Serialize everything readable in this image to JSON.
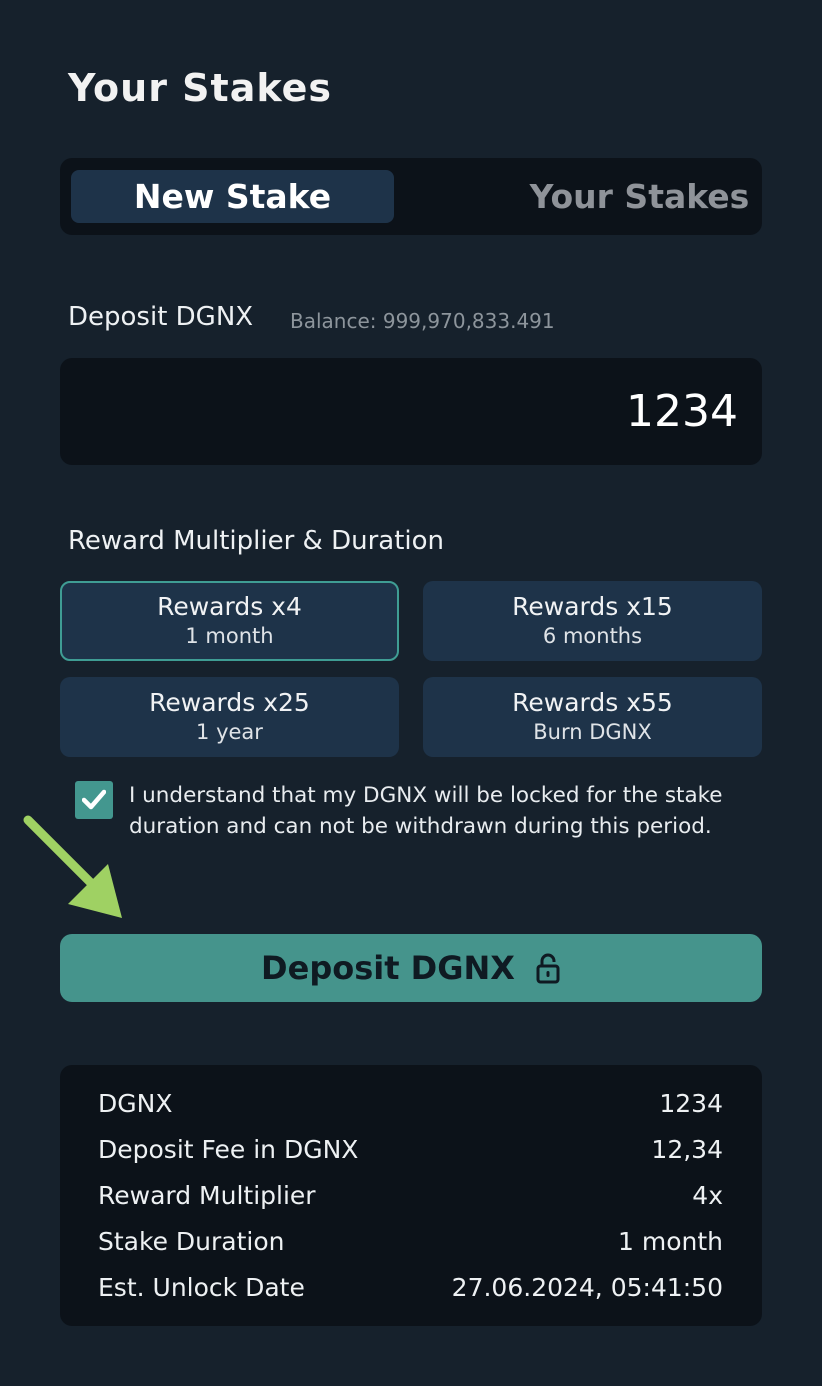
{
  "page": {
    "title": "Your Stakes"
  },
  "tabs": [
    {
      "label": "New Stake",
      "active": true
    },
    {
      "label": "Your Stakes",
      "active": false
    }
  ],
  "deposit": {
    "label": "Deposit DGNX",
    "balance": "Balance: 999,970,833.491",
    "amount_value": "1234"
  },
  "multiplier": {
    "label": "Reward Multiplier & Duration",
    "options": [
      {
        "title": "Rewards x4",
        "sub": "1 month",
        "selected": true
      },
      {
        "title": "Rewards x15",
        "sub": "6 months",
        "selected": false
      },
      {
        "title": "Rewards x25",
        "sub": "1 year",
        "selected": false
      },
      {
        "title": "Rewards x55",
        "sub": "Burn DGNX",
        "selected": false
      }
    ]
  },
  "agreement": {
    "checked": true,
    "text": "I understand that my DGNX will be locked for the stake duration and can not be withdrawn during this period."
  },
  "deposit_button": {
    "label": "Deposit DGNX",
    "icon": "lock-icon"
  },
  "annotation": {
    "icon": "arrow-pointer-icon",
    "color": "#9fd163"
  },
  "summary": {
    "rows": [
      {
        "key": "DGNX",
        "value": "1234"
      },
      {
        "key": "Deposit Fee in DGNX",
        "value": "12,34"
      },
      {
        "key": "Reward Multiplier",
        "value": "4x"
      },
      {
        "key": "Stake Duration",
        "value": "1 month"
      },
      {
        "key": "Est. Unlock Date",
        "value": "27.06.2024, 05:41:50"
      }
    ]
  },
  "colors": {
    "background": "#16212c",
    "panel": "#0c1219",
    "card": "#1e3349",
    "accent": "#45948c",
    "muted_text": "#8f9399"
  }
}
